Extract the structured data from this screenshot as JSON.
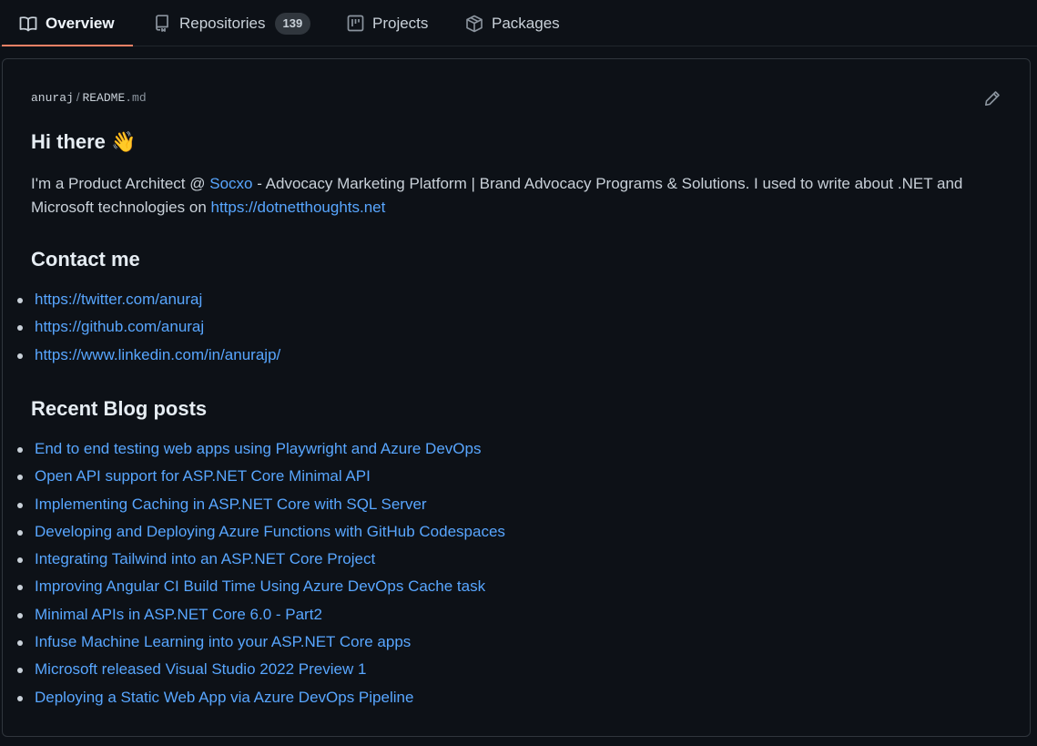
{
  "tabs": [
    {
      "label": "Overview",
      "icon": "book-icon",
      "selected": true
    },
    {
      "label": "Repositories",
      "icon": "repo-icon",
      "count": "139"
    },
    {
      "label": "Projects",
      "icon": "project-icon"
    },
    {
      "label": "Packages",
      "icon": "package-icon"
    }
  ],
  "readme": {
    "owner": "anuraj",
    "separator": "/",
    "file_name": "README",
    "file_ext": ".md",
    "edit_icon": "pencil-icon",
    "greeting": "Hi there 👋",
    "intro": {
      "before_link": "I'm a Product Architect @ ",
      "company_link": "Socxo",
      "after_link": " - Advocacy Marketing Platform | Brand Advocacy Programs & Solutions. I used to write about .NET and Microsoft technologies on ",
      "blog_link": "https://dotnetthoughts.net"
    },
    "contact_heading": "Contact me",
    "contact_links": [
      "https://twitter.com/anuraj",
      "https://github.com/anuraj",
      "https://www.linkedin.com/in/anurajp/"
    ],
    "blog_heading": "Recent Blog posts",
    "blog_posts": [
      "End to end testing web apps using Playwright and Azure DevOps",
      "Open API support for ASP.NET Core Minimal API",
      "Implementing Caching in ASP.NET Core with SQL Server",
      "Developing and Deploying Azure Functions with GitHub Codespaces",
      "Integrating Tailwind into an ASP.NET Core Project",
      "Improving Angular CI Build Time Using Azure DevOps Cache task",
      "Minimal APIs in ASP.NET Core 6.0 - Part2",
      "Infuse Machine Learning into your ASP.NET Core apps",
      "Microsoft released Visual Studio 2022 Preview 1",
      "Deploying a Static Web App via Azure DevOps Pipeline"
    ]
  },
  "colors": {
    "background": "#0d1117",
    "link": "#58a6ff",
    "selected_tab_underline": "#f78166",
    "border": "#30363d"
  }
}
